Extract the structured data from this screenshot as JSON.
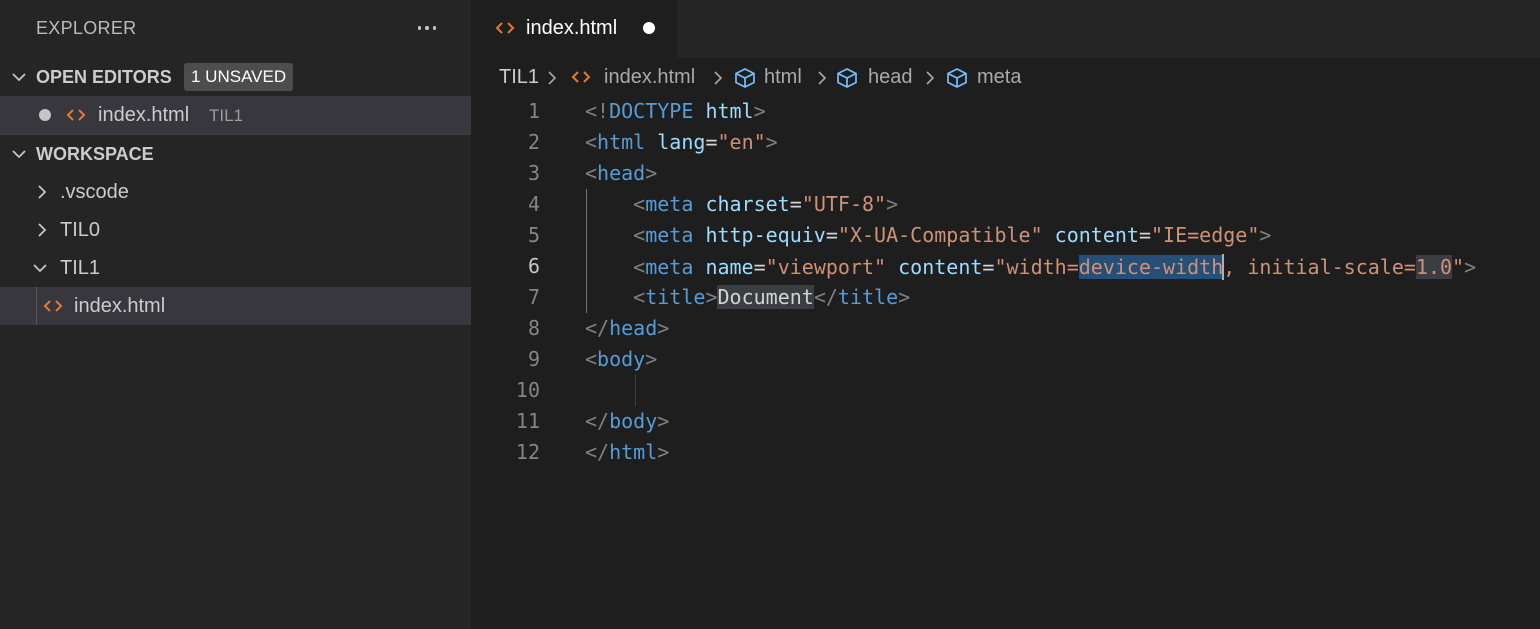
{
  "sidebar": {
    "title": "EXPLORER",
    "open_editors": {
      "title": "OPEN EDITORS",
      "badge": "1 UNSAVED",
      "items": [
        {
          "name": "index.html",
          "description": "TIL1"
        }
      ]
    },
    "workspace": {
      "title": "WORKSPACE",
      "items": [
        {
          "label": ".vscode",
          "type": "folder",
          "expanded": false
        },
        {
          "label": "TIL0",
          "type": "folder",
          "expanded": false
        },
        {
          "label": "TIL1",
          "type": "folder",
          "expanded": true
        },
        {
          "label": "index.html",
          "type": "file"
        }
      ]
    }
  },
  "tab": {
    "label": "index.html",
    "unsaved": true
  },
  "breadcrumb": [
    "TIL1",
    "index.html",
    "html",
    "head",
    "meta"
  ],
  "editor": {
    "active_line": 6,
    "line_numbers": [
      "1",
      "2",
      "3",
      "4",
      "5",
      "6",
      "7",
      "8",
      "9",
      "10",
      "11",
      "12"
    ]
  },
  "colors": {
    "html_icon": "#e37933",
    "tag": "#569cd6",
    "attribute": "#9cdcfe",
    "string": "#ce9178",
    "bracket": "#808080",
    "selection": "#264f78"
  }
}
